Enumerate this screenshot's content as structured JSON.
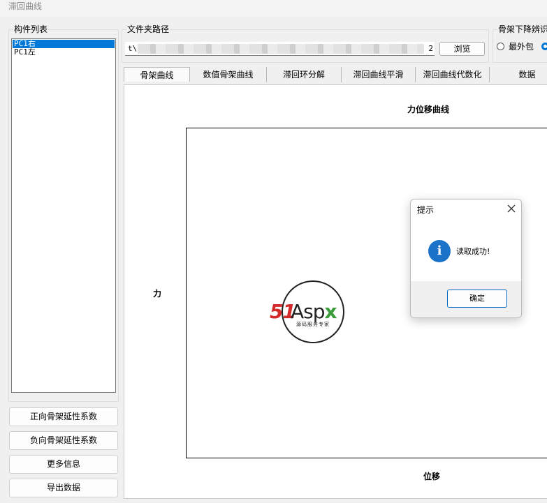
{
  "window": {
    "title": "滞回曲线"
  },
  "components": {
    "label": "构件列表",
    "items": [
      "PC1右",
      "PC1左"
    ],
    "selected_index": 0
  },
  "side_buttons": {
    "positive_ductility": "正向骨架延性系数",
    "negative_ductility": "负向骨架延性系数",
    "more_info": "更多信息",
    "export": "导出数据"
  },
  "folder": {
    "label": "文件夹路径",
    "path_value": "t\\",
    "path_tail": "2",
    "browse_label": "浏览"
  },
  "skeleton_descent": {
    "label": "骨架下降辨识",
    "option_outer": "最外包"
  },
  "tabs": [
    "骨架曲线",
    "数值骨架曲线",
    "滞回环分解",
    "滞回曲线平滑",
    "滞回曲线代数化",
    "数据"
  ],
  "active_tab": 0,
  "chart": {
    "title": "力位移曲线",
    "xlabel": "位移",
    "ylabel": "力"
  },
  "watermark": {
    "brand_51": "51",
    "brand_asp": "Asp",
    "brand_x": "x",
    "tagline": "源码服务专家"
  },
  "dialog": {
    "title": "提示",
    "message": "读取成功!",
    "ok_label": "确定",
    "info_icon_glyph": "i"
  },
  "colors": {
    "selection": "#0078d7",
    "info_icon": "#1a73c9",
    "window_bg": "#f0f0f0"
  }
}
